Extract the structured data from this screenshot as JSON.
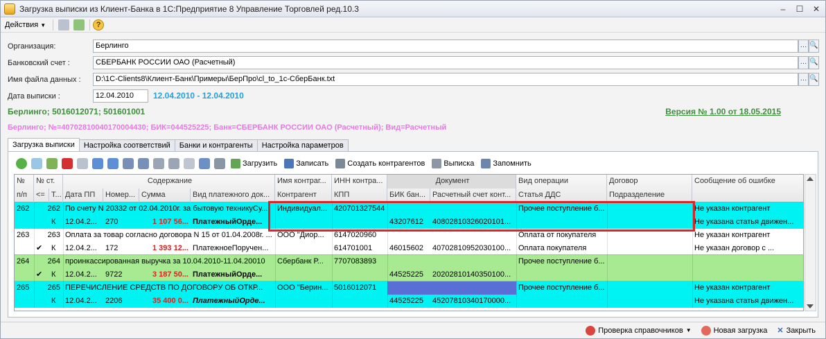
{
  "window": {
    "title": "Загрузка выписки из Клиент-Банка в 1С:Предприятие 8 Управление Торговлей ред.10.3"
  },
  "menu": {
    "actions_label": "Действия",
    "help": "?"
  },
  "form": {
    "org_label": "Организация:",
    "org_value": "Берлинго",
    "bank_label": "Банковский счет :",
    "bank_value": "СБЕРБАНК РОССИИ ОАО (Расчетный)",
    "file_label": "Имя файла данных :",
    "file_value": "D:\\1C-Clients8\\Клиент-Банк\\Примеры\\БерПро\\cl_to_1c-СберБанк.txt",
    "date_label": "Дата выписки :",
    "date_value": "12.04.2010",
    "date_range": "12.04.2010 - 12.04.2010",
    "company_info": "Берлинго; 5016012071; 501601001",
    "version": "Версия № 1.00 от 18.05.2015",
    "account_info": "Берлинго; №=40702810040170004430; БИК=044525225; Банк=СБЕРБАНК РОССИИ ОАО (Расчетный); Вид=Расчетный"
  },
  "tabs": [
    "Загрузка выписки",
    "Настройка соответствий",
    "Банки и контрагенты",
    "Настройка параметров"
  ],
  "toolbar": {
    "load": "Загрузить",
    "save": "Записать",
    "create": "Создать контрагентов",
    "statement": "Выписка",
    "remember": "Запомнить"
  },
  "grid": {
    "headers_top": {
      "n": "№",
      "nst": "№ ст.",
      "content": "Содержание",
      "name": "Имя контраг...",
      "inn": "ИНН контра...",
      "doc": "Документ",
      "op": "Вид операции",
      "contract": "Договор",
      "err": "Сообщение об ошибке"
    },
    "headers_bottom": {
      "np": "п/п",
      "le": "<=",
      "t": "Т...",
      "date": "Дата ПП",
      "num": "Номер...",
      "sum": "Сумма",
      "type": "Вид платежного док...",
      "contr": "Контрагент",
      "kpp": "КПП",
      "bik": "БИК бан...",
      "acc": "Расчетный счет конт...",
      "dds": "Статья ДДС",
      "dept": "Подразделение"
    },
    "rows": [
      {
        "n": "262",
        "nst": "262",
        "content": "По счету N 20332 от 02.04.2010г. за бытовую техникуСу...",
        "name": "Индивидуал...",
        "inn": "420701327544",
        "op": "Прочее поступление б...",
        "contract": "",
        "err1": "Не указан контрагент",
        "check": "",
        "t": "К",
        "date": "12.04.2...",
        "num": "270",
        "sum": "1 107 56...",
        "type": "ПлатежныйОрде...",
        "contr": "",
        "kpp": "",
        "bik": "43207612",
        "acc": "40802810326020101...",
        "dds": "",
        "dept": "",
        "err2": "Не указана статья движен..."
      },
      {
        "n": "263",
        "nst": "263",
        "content": "Оплата за товар согласно договора N 15 от 01.04.2008г. ...",
        "name": "ООО \"Диор...",
        "inn": "6147020960",
        "op": "Оплата от покупателя",
        "contract": "",
        "err1": "Не указан контрагент",
        "check": "✔",
        "t": "К",
        "date": "12.04.2...",
        "num": "172",
        "sum": "1 393 12...",
        "type": "ПлатежноеПоручен...",
        "contr": "",
        "kpp": "614701001",
        "bik": "46015602",
        "acc": "40702810952030100...",
        "dds": "Оплата покупателя",
        "dept": "",
        "err2": "Не указан договор с ..."
      },
      {
        "n": "264",
        "nst": "264",
        "content": "проинкассированная выручка за 10.04.2010-11.04.20010",
        "name": "Сбербанк Р...",
        "inn": "7707083893",
        "op": "Прочее поступление б...",
        "contract": "",
        "err1": "",
        "check": "✔",
        "t": "К",
        "date": "12.04.2...",
        "num": "9722",
        "sum": "3 187 50...",
        "type": "ПлатежныйОрде...",
        "contr": "",
        "kpp": "",
        "bik": "44525225",
        "acc": "20202810140350100...",
        "dds": "",
        "dept": "",
        "err2": ""
      },
      {
        "n": "265",
        "nst": "265",
        "content": "ПЕРЕЧИСЛЕНИЕ СРЕДСТВ ПО ДОГОВОРУ ОБ ОТКР...",
        "name": "ООО \"Берин...",
        "inn": "5016012071",
        "op": "Прочее поступление б...",
        "contract": "",
        "err1": "Не указан контрагент",
        "check": "",
        "t": "К",
        "date": "12.04.2...",
        "num": "2206",
        "sum": "35 400 0...",
        "type": "ПлатежныйОрде...",
        "contr": "",
        "kpp": "",
        "bik": "44525225",
        "acc": "45207810340170000...",
        "dds": "",
        "dept": "",
        "err2": "Не указана статья движен..."
      }
    ]
  },
  "bottom": {
    "check": "Проверка справочников",
    "new_load": "Новая загрузка",
    "close": "Закрыть"
  },
  "colors": {
    "cyan": "#00f3f3",
    "green": "#a8ea91",
    "blue_cell": "#5a6fd6",
    "red_frame": "#d9262a"
  }
}
